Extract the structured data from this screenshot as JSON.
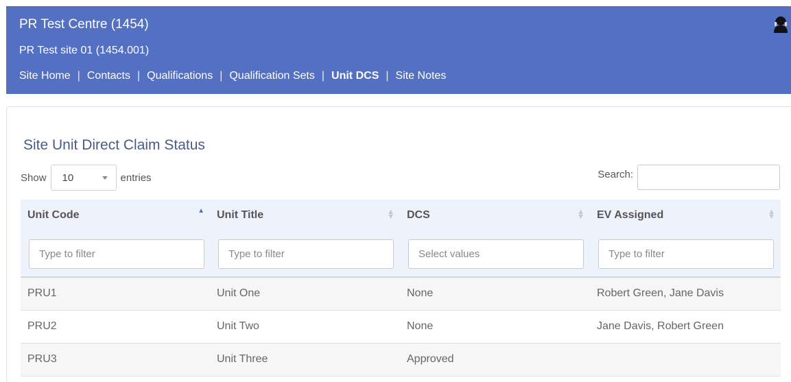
{
  "header": {
    "centre": "PR Test Centre (1454)",
    "site": "PR Test site 01 (1454.001)",
    "nav": [
      {
        "label": "Site Home",
        "active": false
      },
      {
        "label": "Contacts",
        "active": false
      },
      {
        "label": "Qualifications",
        "active": false
      },
      {
        "label": "Qualification Sets",
        "active": false
      },
      {
        "label": "Unit DCS",
        "active": true
      },
      {
        "label": "Site Notes",
        "active": false
      }
    ],
    "separator": "|",
    "user_icon": "user-icon"
  },
  "panel": {
    "title": "Site Unit Direct Claim Status",
    "length": {
      "show_label": "Show",
      "value": "10",
      "entries_label": "entries"
    },
    "search": {
      "label": "Search:",
      "value": ""
    }
  },
  "table": {
    "columns": [
      {
        "label": "Unit Code",
        "sort": "asc"
      },
      {
        "label": "Unit Title",
        "sort": "both"
      },
      {
        "label": "DCS",
        "sort": "both"
      },
      {
        "label": "EV Assigned",
        "sort": "both"
      }
    ],
    "filters": [
      "Type to filter",
      "Type to filter",
      "Select values",
      "Type to filter"
    ],
    "rows": [
      [
        "PRU1",
        "Unit One",
        "None",
        "Robert Green, Jane Davis"
      ],
      [
        "PRU2",
        "Unit Two",
        "None",
        "Jane Davis, Robert Green"
      ],
      [
        "PRU3",
        "Unit Three",
        "Approved",
        ""
      ]
    ]
  },
  "colors": {
    "header_bg": "#5470c3",
    "title": "#475b8a",
    "header_row": "#eef2fa"
  }
}
